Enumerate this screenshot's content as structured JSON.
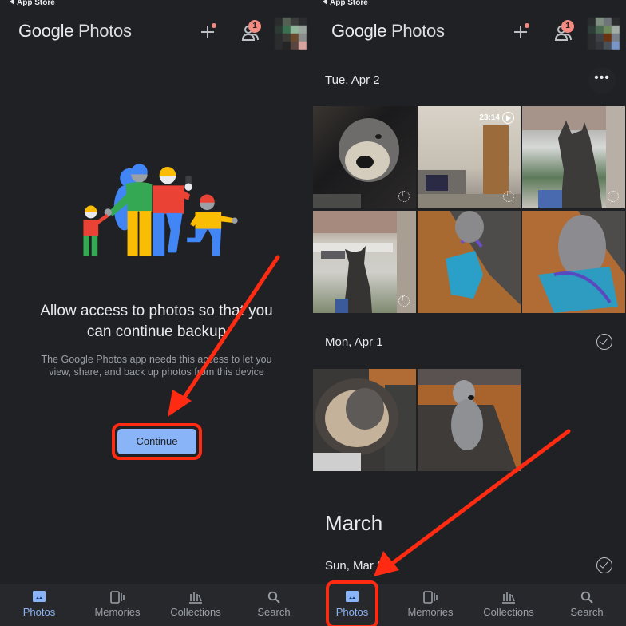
{
  "status_bar": {
    "back_label": "App Store"
  },
  "app": {
    "logo_google": "Google",
    "logo_photos": "Photos",
    "notification_count": "1"
  },
  "left_screen": {
    "headline_line1": "Allow access to photos so that you",
    "headline_line2": "can continue backup",
    "subtext_line1": "The Google Photos app needs this access to let you",
    "subtext_line2": "view, share, and back up photos from this device",
    "continue_label": "Continue"
  },
  "right_screen": {
    "sections": [
      {
        "date": "Tue, Apr 2",
        "action": "more-options"
      },
      {
        "date": "Mon, Apr 1",
        "action": "select-check"
      }
    ],
    "month_header": "March",
    "last_date": "Sun, Mar 3",
    "video_duration": "23:14",
    "more_glyph": "•••"
  },
  "bottom_nav": {
    "items": [
      {
        "label": "Photos",
        "icon": "photo-icon",
        "active": true
      },
      {
        "label": "Memories",
        "icon": "memories-icon",
        "active": false
      },
      {
        "label": "Collections",
        "icon": "collections-icon",
        "active": false
      },
      {
        "label": "Search",
        "icon": "search-icon",
        "active": false
      }
    ]
  },
  "colors": {
    "background": "#202124",
    "accent": "#8ab4f8",
    "annotation_red": "#ff2a12",
    "badge": "#f28b82"
  }
}
